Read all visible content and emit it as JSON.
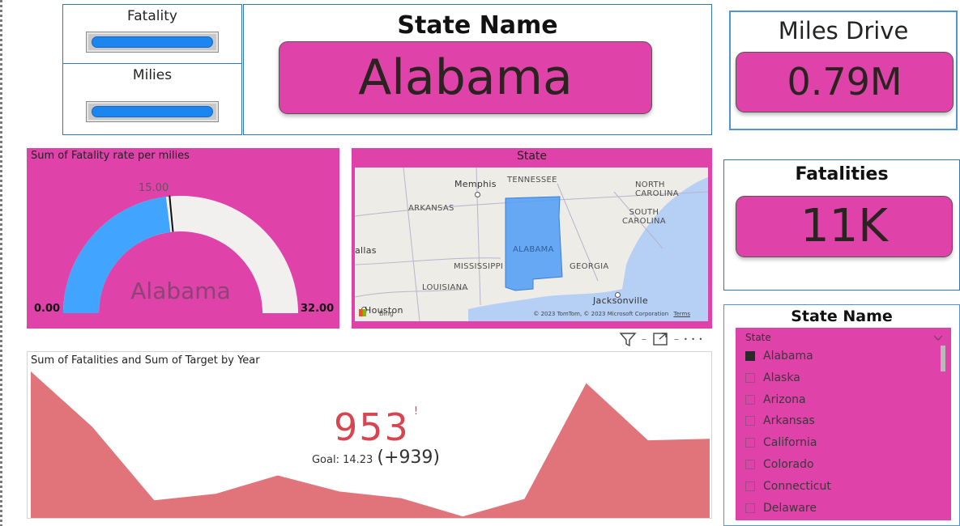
{
  "slicers": {
    "fatality": {
      "label": "Fatality"
    },
    "milies": {
      "label": "Milies"
    }
  },
  "state_card": {
    "title": "State Name",
    "value": "Alabama"
  },
  "miles_card": {
    "title": "Miles Drive",
    "value": "0.79M"
  },
  "fatalities_card": {
    "title": "Fatalities",
    "value": "11K"
  },
  "gauge": {
    "title": "Sum of Fatality rate per milies",
    "center_label": "Alabama",
    "min_label": "0.00",
    "max_label": "32.00",
    "target_label": "15.00",
    "value_fraction": 0.46,
    "target_fraction": 0.47
  },
  "map": {
    "title": "State",
    "labels": {
      "tennessee": "TENNESSEE",
      "north_carolina": "NORTH CAROLINA",
      "arkansas": "ARKANSAS",
      "south_carolina": "SOUTH\nCAROLINA",
      "alabama": "ALABAMA",
      "mississippi": "MISSISSIPPI",
      "georgia": "GEORGIA",
      "louisiana": "LOUISIANA"
    },
    "cities": {
      "memphis": "Memphis",
      "dallas": "allas",
      "houston": "Houston",
      "jacksonville": "Jacksonville"
    },
    "attribution": "© 2023 TomTom, © 2023 Microsoft Corporation",
    "terms": "Terms",
    "bing": "Bing"
  },
  "visual_header": {
    "filter_icon": "filter-icon",
    "focus_icon": "focus-mode-icon",
    "more_label": "• • •"
  },
  "chart": {
    "title": "Sum of Fatalities and Sum of Target by Year",
    "kpi_value": "953",
    "kpi_indicator": "!",
    "goal_label": "Goal: 14.23",
    "goal_delta": "(+939)"
  },
  "chart_data": {
    "type": "area",
    "title": "Sum of Fatalities and Sum of Target by Year",
    "xlabel": "",
    "ylabel": "",
    "values": [
      1000,
      620,
      120,
      165,
      290,
      180,
      135,
      10,
      130,
      920,
      530,
      540
    ],
    "ylim": [
      0,
      1000
    ],
    "grid": false,
    "color": "#e0747a"
  },
  "state_slicer": {
    "title": "State Name",
    "header": "State",
    "items": [
      {
        "label": "Alabama",
        "checked": true
      },
      {
        "label": "Alaska",
        "checked": false
      },
      {
        "label": "Arizona",
        "checked": false
      },
      {
        "label": "Arkansas",
        "checked": false
      },
      {
        "label": "California",
        "checked": false
      },
      {
        "label": "Colorado",
        "checked": false
      },
      {
        "label": "Connecticut",
        "checked": false
      },
      {
        "label": "Delaware",
        "checked": false
      }
    ]
  },
  "colors": {
    "accent": "#df42a8",
    "gauge_fill": "#41a4ff",
    "gauge_rest": "#f2f0ef",
    "area": "#e0747a",
    "kpi": "#d64550"
  }
}
